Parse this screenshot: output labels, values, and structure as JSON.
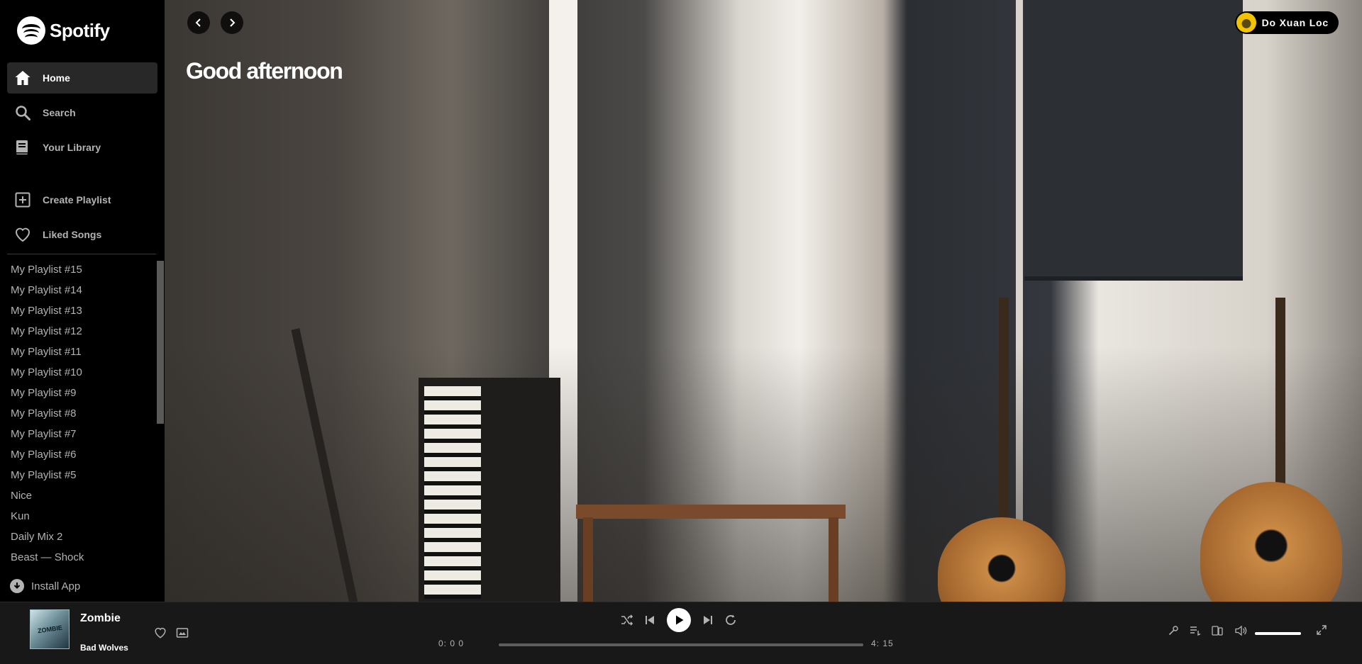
{
  "app": {
    "logo_text": "Spotify"
  },
  "sidebar": {
    "nav": [
      {
        "label": "Home",
        "icon": "home-icon",
        "active": true
      },
      {
        "label": "Search",
        "icon": "search-icon",
        "active": false
      },
      {
        "label": "Your Library",
        "icon": "library-icon",
        "active": false
      }
    ],
    "actions": [
      {
        "label": "Create Playlist",
        "icon": "plus-square-icon"
      },
      {
        "label": "Liked Songs",
        "icon": "heart-icon"
      }
    ],
    "playlists": [
      "My Playlist #15",
      "My Playlist #14",
      "My Playlist #13",
      "My Playlist #12",
      "My Playlist #11",
      "My Playlist #10",
      "My Playlist #9",
      "My Playlist #8",
      "My Playlist #7",
      "My Playlist #6",
      "My Playlist #5",
      "Nice",
      "Kun",
      "Daily Mix 2",
      "Beast — Shock"
    ],
    "install_label": "Install App"
  },
  "header": {
    "user_name": "Do Xuan Loc",
    "greeting": "Good afternoon"
  },
  "player": {
    "track_title": "Zombie",
    "track_artist": "Bad Wolves",
    "cover_text": "ZOMBIE",
    "current_time": "0: 0 0",
    "total_time": "4: 15",
    "progress_fraction": 0,
    "volume_fraction": 1
  },
  "colors": {
    "sidebar_bg": "#000000",
    "player_bg": "#181818",
    "active_item_bg": "#282828",
    "text_muted": "#b3b3b3"
  }
}
